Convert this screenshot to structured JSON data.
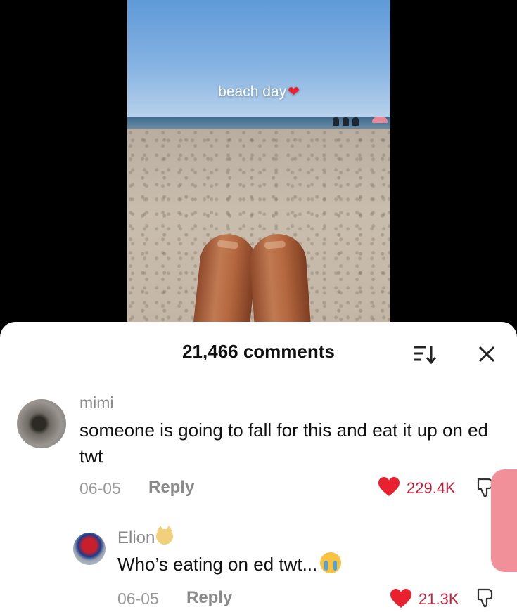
{
  "video": {
    "caption": "beach day",
    "caption_emoji": "red-heart"
  },
  "comments_sheet": {
    "title": "21,466 comments",
    "sort_icon": "sort-icon",
    "close_icon": "close-icon",
    "comments": [
      {
        "username": "mimi",
        "text": "someone is going to fall for this and eat it up on ed twt",
        "date": "06-05",
        "reply_label": "Reply",
        "likes": "229.4K",
        "liked": true
      },
      {
        "username": "Elion",
        "username_emoji": "cat-face",
        "text": "Who’s eating on ed twt...",
        "text_emoji": "loudly-crying-face",
        "date": "06-05",
        "reply_label": "Reply",
        "likes": "21.3K",
        "liked": true
      }
    ]
  },
  "colors": {
    "like_red": "#e8202f",
    "likes_text": "#c0223c",
    "scrollbar": "#f2909a"
  }
}
